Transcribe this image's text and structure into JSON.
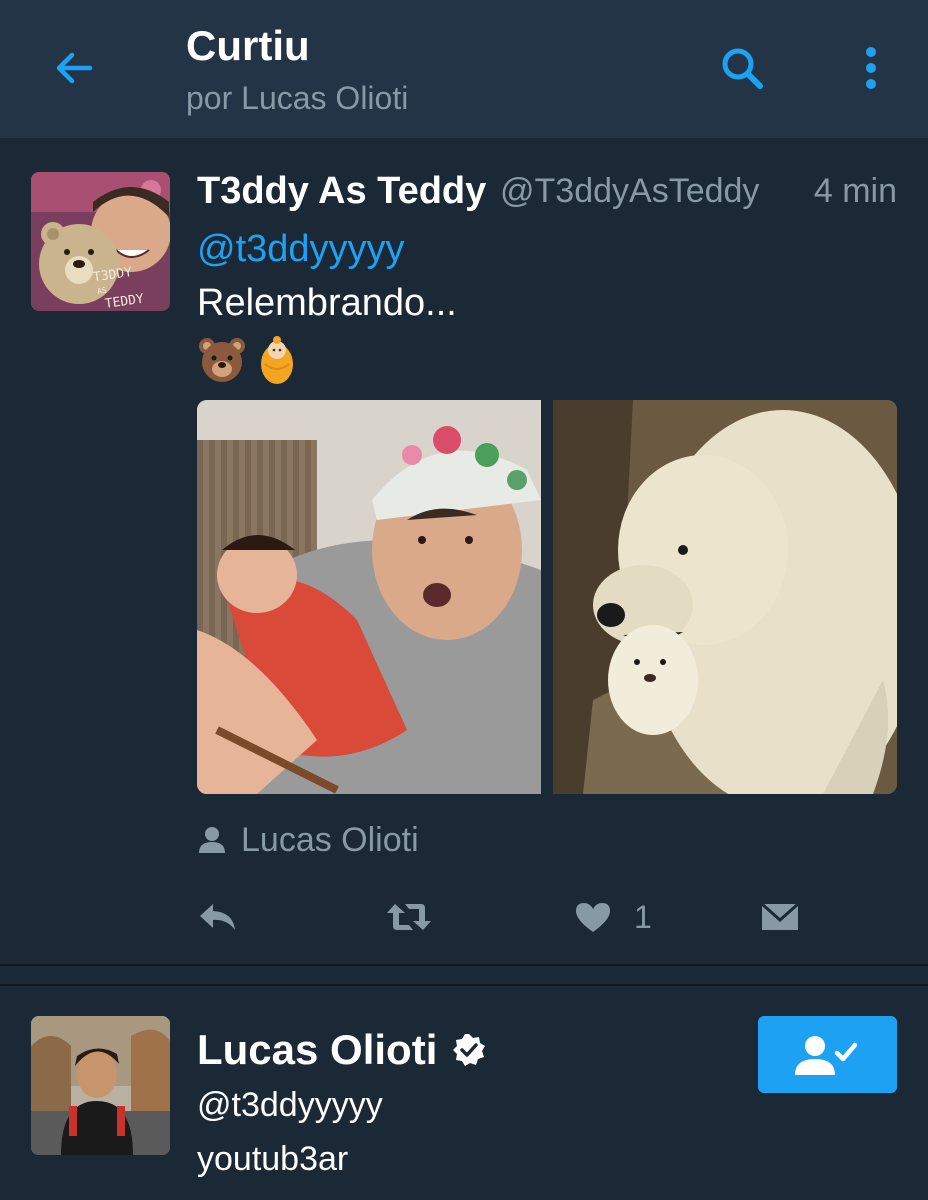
{
  "header": {
    "title": "Curtiu",
    "subtitle": "por Lucas Olioti"
  },
  "tweet": {
    "author_name": "T3ddy As Teddy",
    "author_handle": "@T3ddyAsTeddy",
    "time": "4 min",
    "mention": "@t3ddyyyyy",
    "text": "Relembrando...",
    "emojis": [
      "bear-face",
      "baby"
    ],
    "avatar_overlay": [
      "T3DDY",
      "AS",
      "TEDDY"
    ],
    "liked_by": "Lucas Olioti",
    "like_count": "1"
  },
  "user_card": {
    "name": "Lucas Olioti",
    "handle": "@t3ddyyyyy",
    "bio": "youtub3ar",
    "verified": true
  },
  "colors": {
    "background": "#1b2836",
    "header_bg": "#243447",
    "accent": "#1da1f2",
    "muted": "#8899a6"
  }
}
